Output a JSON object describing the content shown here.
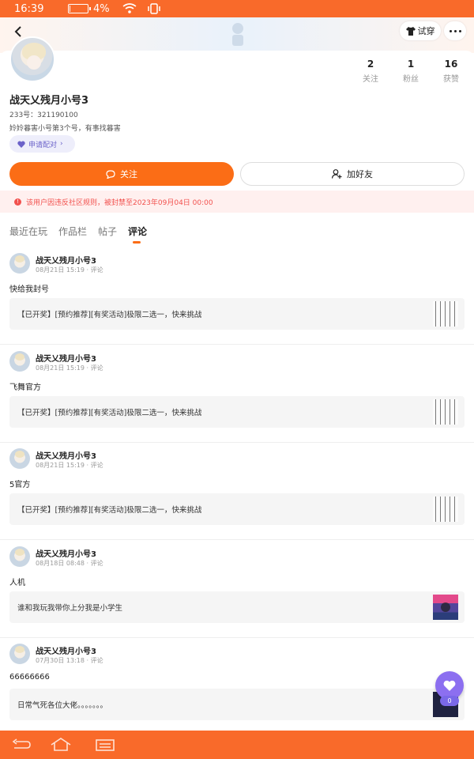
{
  "status_bar": {
    "time": "16:39",
    "battery_percent_text": "4%",
    "battery_level": 0.04
  },
  "header": {
    "tryon_label": "试穿"
  },
  "profile": {
    "stats": [
      {
        "count": "2",
        "label": "关注"
      },
      {
        "count": "1",
        "label": "粉丝"
      },
      {
        "count": "16",
        "label": "获赞"
      }
    ],
    "username": "战天乂残月小号3",
    "uid_text": "233号：321190100",
    "bio": "姈姈暮害小号第3个号，有事找暮害",
    "pair_label": "申请配对",
    "follow_label": "关注",
    "add_friend_label": "加好友",
    "ban_notice": "该用户因违反社区规则，被封禁至2023年09月04日 00:00"
  },
  "tabs": [
    {
      "label": "最近在玩",
      "active": false
    },
    {
      "label": "作品栏",
      "active": false
    },
    {
      "label": "帖子",
      "active": false
    },
    {
      "label": "评论",
      "active": true
    }
  ],
  "posts": [
    {
      "author": "战天乂残月小号3",
      "meta": "08月21日 15:19 · 评论",
      "text": "快给我封号",
      "quote": "【已开奖】[预约推荐][有奖活动]极限二选一，快来挑战",
      "thumb": "qr"
    },
    {
      "author": "战天乂残月小号3",
      "meta": "08月21日 15:19 · 评论",
      "text": "飞舞官方",
      "quote": "【已开奖】[预约推荐][有奖活动]极限二选一，快来挑战",
      "thumb": "qr"
    },
    {
      "author": "战天乂残月小号3",
      "meta": "08月21日 15:19 · 评论",
      "text": "5官方",
      "quote": "【已开奖】[预约推荐][有奖活动]极限二选一，快来挑战",
      "thumb": "qr"
    },
    {
      "author": "战天乂残月小号3",
      "meta": "08月18日 08:48 · 评论",
      "text": "人机",
      "quote": "谁和我玩我带你上分我是小学生",
      "thumb": "image"
    },
    {
      "author": "战天乂残月小号3",
      "meta": "07月30日 13:18 · 评论",
      "text": "66666666",
      "quote": "日常气死各位大佬。。。。。。。",
      "thumb": "dark"
    }
  ],
  "fab": {
    "icon": "heart-icon",
    "badge": "0"
  },
  "colors": {
    "accent": "#fb6d16",
    "status_bar": "#f96a2a",
    "ban_text": "#f2514e",
    "pair_text": "#6b62c9",
    "fab": "#8c6ff0"
  }
}
